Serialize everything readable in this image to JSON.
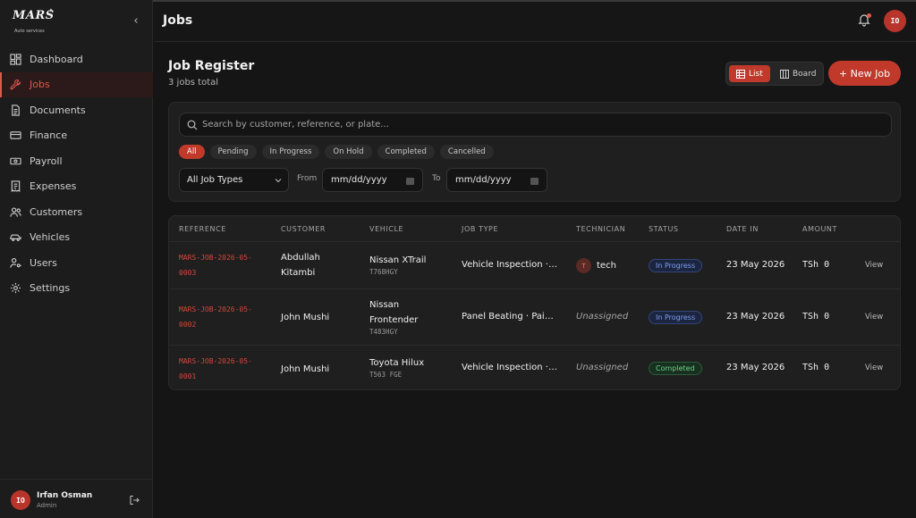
{
  "app": {
    "logo_text": "MARS",
    "logo_sub": "Auto services"
  },
  "sidebar": {
    "items": [
      {
        "label": "Dashboard",
        "icon": "dashboard-icon"
      },
      {
        "label": "Jobs",
        "icon": "wrench-icon",
        "active": true
      },
      {
        "label": "Documents",
        "icon": "document-icon"
      },
      {
        "label": "Finance",
        "icon": "card-icon"
      },
      {
        "label": "Payroll",
        "icon": "banknote-icon"
      },
      {
        "label": "Expenses",
        "icon": "receipt-icon"
      },
      {
        "label": "Customers",
        "icon": "people-icon"
      },
      {
        "label": "Vehicles",
        "icon": "car-icon"
      },
      {
        "label": "Users",
        "icon": "user-key-icon"
      },
      {
        "label": "Settings",
        "icon": "gear-icon"
      }
    ],
    "user": {
      "initials": "IO",
      "name": "Irfan Osman",
      "role": "Admin"
    }
  },
  "header": {
    "title": "Jobs",
    "avatar_initials": "IO"
  },
  "register": {
    "title": "Job Register",
    "count": "3 jobs total",
    "view_list": "List",
    "view_board": "Board",
    "new_job": "+ New Job"
  },
  "filters": {
    "search_placeholder": "Search by customer, reference, or plate...",
    "chips": [
      "All",
      "Pending",
      "In Progress",
      "On Hold",
      "Completed",
      "Cancelled"
    ],
    "active_chip": "All",
    "job_type": "All Job Types",
    "from_label": "From",
    "to_label": "To",
    "date_placeholder": "mm/dd/yyyy"
  },
  "table": {
    "headers": [
      "REFERENCE",
      "CUSTOMER",
      "VEHICLE",
      "JOB TYPE",
      "TECHNICIAN",
      "STATUS",
      "DATE IN",
      "AMOUNT"
    ],
    "rows": [
      {
        "ref1": "MARS-JOB-2026-05-",
        "ref2": "0003",
        "customer1": "Abdullah",
        "customer2": "Kitambi",
        "vehicle1": "Nissan XTrail",
        "vehicle2": "",
        "plate": "T768HGY",
        "job_type": "Vehicle Inspection · ...",
        "tech_initial": "T",
        "tech": "tech",
        "status": "In Progress",
        "date_in": "23 May 2026",
        "amount": "TSh 0",
        "action": "View"
      },
      {
        "ref1": "MARS-JOB-2026-05-",
        "ref2": "0002",
        "customer1": "John Mushi",
        "customer2": "",
        "vehicle1": "Nissan",
        "vehicle2": "Frontender",
        "plate": "T483HGY",
        "job_type": "Panel Beating · Pain...",
        "tech": "Unassigned",
        "status": "In Progress",
        "date_in": "23 May 2026",
        "amount": "TSh 0",
        "action": "View"
      },
      {
        "ref1": "MARS-JOB-2026-05-",
        "ref2": "0001",
        "customer1": "John Mushi",
        "customer2": "",
        "vehicle1": "Toyota Hilux",
        "vehicle2": "",
        "plate": "T563 FGE",
        "job_type": "Vehicle Inspection · ...",
        "tech": "Unassigned",
        "status": "Completed",
        "date_in": "23 May 2026",
        "amount": "TSh 0",
        "action": "View"
      }
    ]
  },
  "colors": {
    "accent": "#c0392b",
    "accent_text": "#e0584c",
    "in_progress": "#7c9ff0",
    "completed": "#6fd38b"
  }
}
